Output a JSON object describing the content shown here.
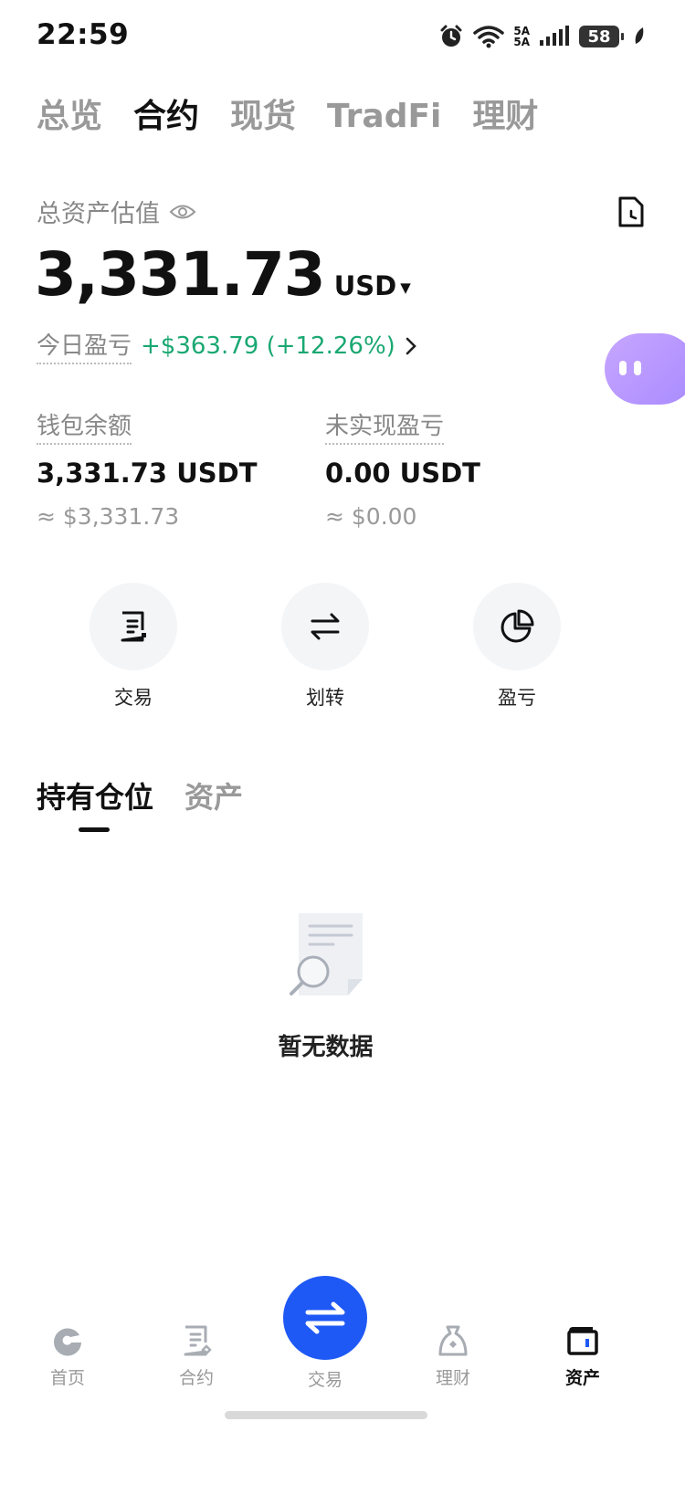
{
  "status_bar": {
    "time": "22:59",
    "network_1": "5A",
    "network_2": "5A",
    "battery": "58"
  },
  "top_tabs": [
    {
      "label": "总览",
      "active": false
    },
    {
      "label": "合约",
      "active": true
    },
    {
      "label": "现货",
      "active": false
    },
    {
      "label": "TradFi",
      "active": false
    },
    {
      "label": "理财",
      "active": false
    }
  ],
  "summary": {
    "label": "总资产估值",
    "total": "3,331.73",
    "currency": "USD",
    "pnl_label": "今日盈亏",
    "pnl_value": "+$363.79 (+12.26%)"
  },
  "balances": {
    "wallet": {
      "label": "钱包余额",
      "value": "3,331.73 USDT",
      "approx": "≈ $3,331.73"
    },
    "unrealized": {
      "label": "未实现盈亏",
      "value": "0.00 USDT",
      "approx": "≈ $0.00"
    }
  },
  "actions": [
    {
      "label": "交易",
      "icon": "trade-doc-icon"
    },
    {
      "label": "划转",
      "icon": "transfer-icon"
    },
    {
      "label": "盈亏",
      "icon": "pie-chart-icon"
    }
  ],
  "position_tabs": [
    {
      "label": "持有仓位",
      "active": true
    },
    {
      "label": "资产",
      "active": false
    }
  ],
  "empty": {
    "text": "暂无数据"
  },
  "bottom_nav": [
    {
      "label": "首页",
      "icon": "home-icon"
    },
    {
      "label": "合约",
      "icon": "contract-icon"
    },
    {
      "label": "交易",
      "icon": "swap-icon"
    },
    {
      "label": "理财",
      "icon": "finance-bag-icon"
    },
    {
      "label": "资产",
      "icon": "wallet-icon"
    }
  ],
  "colors": {
    "accent": "#1f59f5",
    "profit": "#1aa872",
    "muted": "#999999"
  }
}
